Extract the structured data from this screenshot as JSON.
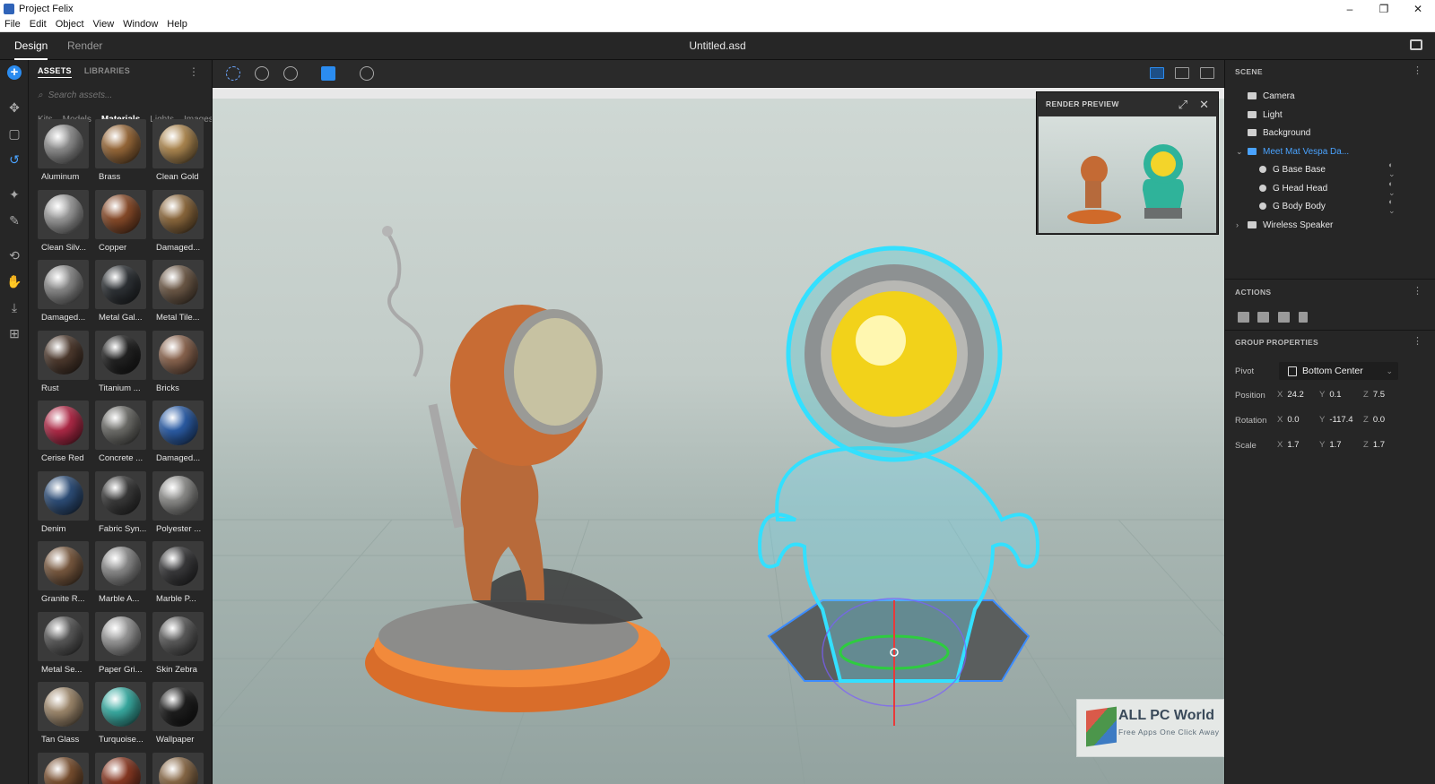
{
  "window": {
    "title": "Project Felix",
    "minimize": "–",
    "maximize": "❐",
    "close": "✕"
  },
  "menu": [
    "File",
    "Edit",
    "Object",
    "View",
    "Window",
    "Help"
  ],
  "header": {
    "tabs": [
      {
        "label": "Design",
        "active": true
      },
      {
        "label": "Render",
        "active": false
      }
    ],
    "document_title": "Untitled.asd"
  },
  "assets": {
    "tabs": [
      "ASSETS",
      "LIBRARIES"
    ],
    "search_placeholder": "Search assets...",
    "categories": [
      "Kits",
      "Models",
      "Materials",
      "Lights",
      "Images"
    ],
    "active_category": "Materials",
    "items": [
      {
        "label": "Aluminum",
        "color": "#8f8f8f"
      },
      {
        "label": "Brass",
        "color": "#9a6a3a"
      },
      {
        "label": "Clean Gold",
        "color": "#b08a52"
      },
      {
        "label": "Clean Silv...",
        "color": "#9c9c9c"
      },
      {
        "label": "Copper",
        "color": "#8a4c2a"
      },
      {
        "label": "Damaged...",
        "color": "#8e6a3e"
      },
      {
        "label": "Damaged...",
        "color": "#8a8a8a"
      },
      {
        "label": "Metal Gal...",
        "color": "#2e3236"
      },
      {
        "label": "Metal Tile...",
        "color": "#6e5a48"
      },
      {
        "label": "Rust",
        "color": "#4e3a2e"
      },
      {
        "label": "Titanium ...",
        "color": "#222222"
      },
      {
        "label": "Bricks",
        "color": "#8c6650"
      },
      {
        "label": "Cerise Red",
        "color": "#b22a48"
      },
      {
        "label": "Concrete ...",
        "color": "#6e6e6a"
      },
      {
        "label": "Damaged...",
        "color": "#2c5ea8"
      },
      {
        "label": "Denim",
        "color": "#2e4f7a"
      },
      {
        "label": "Fabric Syn...",
        "color": "#3a3a3a"
      },
      {
        "label": "Polyester ...",
        "color": "#8e8e8c"
      },
      {
        "label": "Granite R...",
        "color": "#7a5a40"
      },
      {
        "label": "Marble A...",
        "color": "#8c8c8c"
      },
      {
        "label": "Marble P...",
        "color": "#3a3a3c"
      },
      {
        "label": "Metal Se...",
        "color": "#5a5a5a"
      },
      {
        "label": "Paper Gri...",
        "color": "#9a9a9a"
      },
      {
        "label": "Skin Zebra",
        "color": "#5c5c5c"
      },
      {
        "label": "Tan Glass",
        "color": "#a08a6e"
      },
      {
        "label": "Turquoise...",
        "color": "#3aaea4"
      },
      {
        "label": "Wallpaper",
        "color": "#1e1e1e"
      },
      {
        "label": "",
        "color": "#7a5030"
      },
      {
        "label": "",
        "color": "#8a3a24"
      },
      {
        "label": "",
        "color": "#8a6a48"
      }
    ]
  },
  "render_preview": {
    "title": "RENDER PREVIEW"
  },
  "scene": {
    "title": "SCENE",
    "items": [
      {
        "label": "Camera",
        "indent": 0,
        "icon": "camera-icon"
      },
      {
        "label": "Light",
        "indent": 0,
        "icon": "light-icon"
      },
      {
        "label": "Background",
        "indent": 0,
        "icon": "background-icon"
      },
      {
        "label": "Meet Mat Vespa Da...",
        "indent": 0,
        "icon": "folder-icon",
        "highlight": true,
        "expanded": true
      },
      {
        "label": "G Base Base",
        "indent": 1,
        "icon": "group-icon"
      },
      {
        "label": "G Head Head",
        "indent": 1,
        "icon": "group-icon"
      },
      {
        "label": "G Body Body",
        "indent": 1,
        "icon": "group-icon"
      },
      {
        "label": "Wireless Speaker",
        "indent": 0,
        "icon": "folder-icon",
        "collapsed": true
      }
    ]
  },
  "actions": {
    "title": "ACTIONS"
  },
  "group_properties": {
    "title": "GROUP PROPERTIES",
    "pivot_label": "Pivot",
    "pivot_value": "Bottom Center",
    "rows": [
      {
        "label": "Position",
        "x": "24.2",
        "y": "0.1",
        "z": "7.5"
      },
      {
        "label": "Rotation",
        "x": "0.0",
        "y": "-117.4",
        "z": "0.0"
      },
      {
        "label": "Scale",
        "x": "1.7",
        "y": "1.7",
        "z": "1.7"
      }
    ]
  },
  "watermark": {
    "title": "ALL PC World",
    "subtitle": "Free Apps One Click Away"
  },
  "colors": {
    "accent": "#2b8cf0",
    "highlight": "#4aa3ff",
    "glow": "#33e0ff"
  }
}
